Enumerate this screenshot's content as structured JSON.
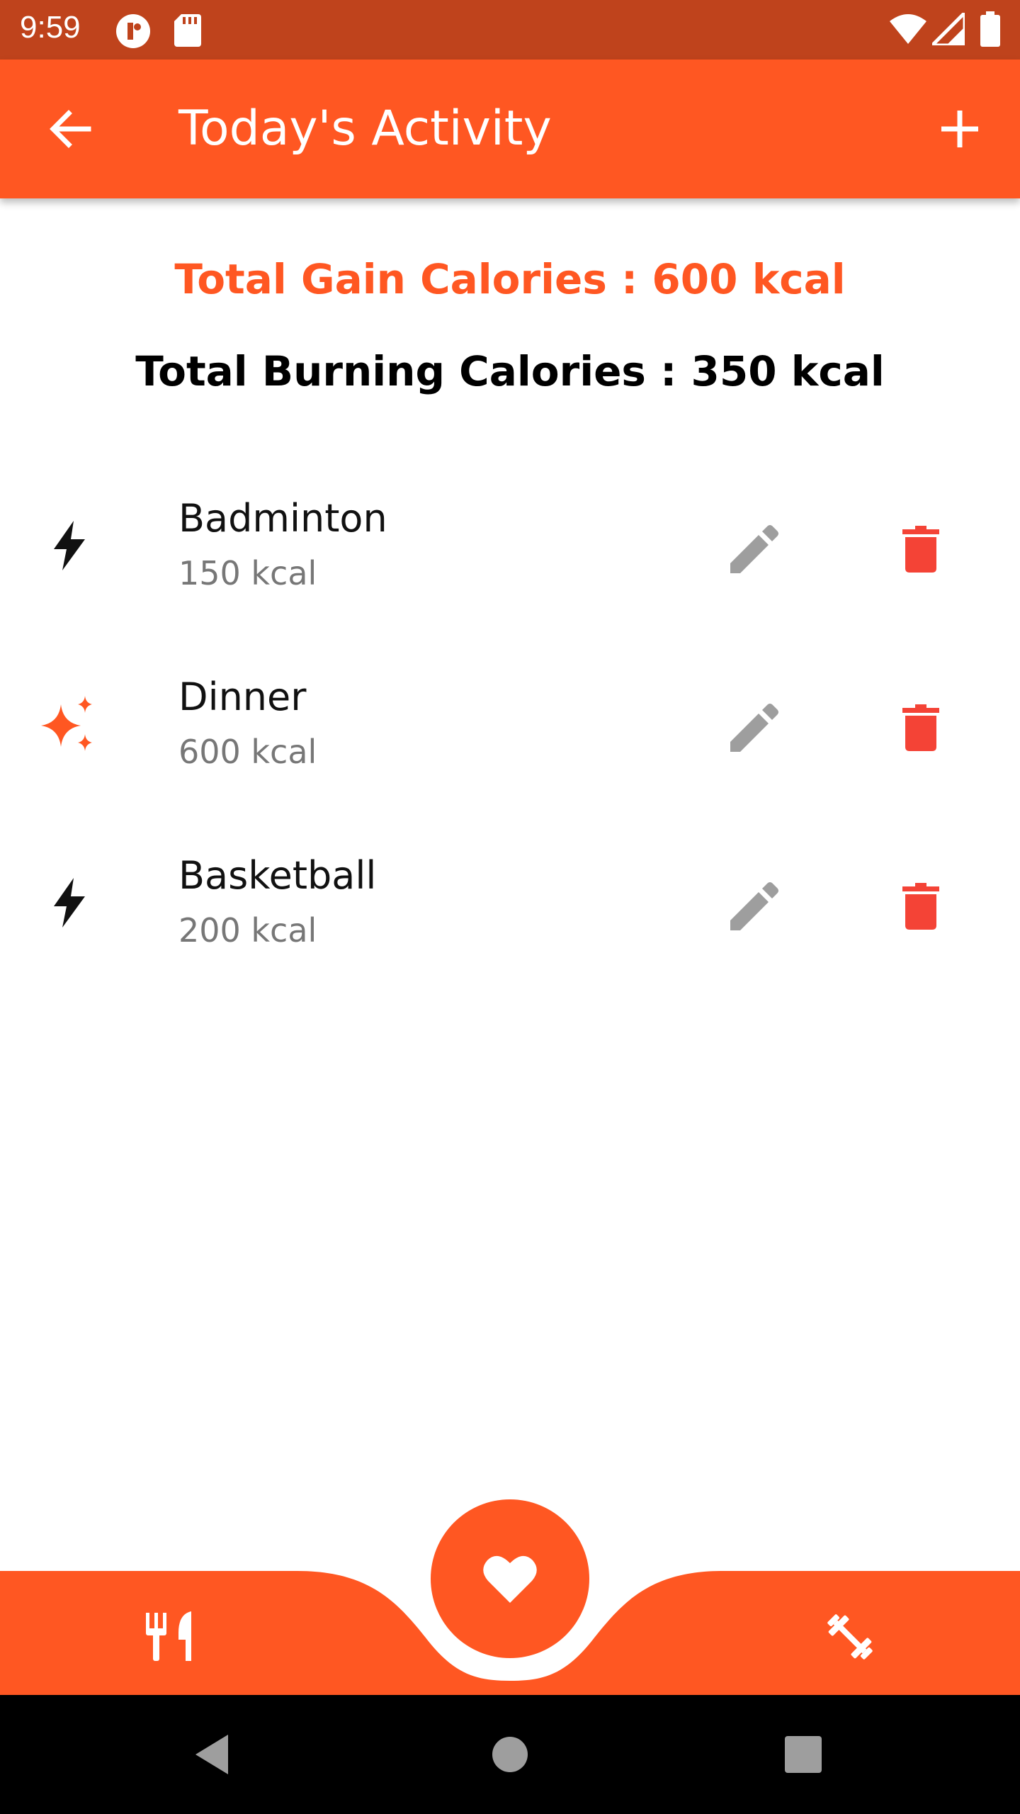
{
  "status_bar": {
    "time": "9:59"
  },
  "app_bar": {
    "title": "Today's Activity"
  },
  "summary": {
    "gain": "Total Gain Calories : 600 kcal",
    "burn": "Total Burning Calories : 350 kcal"
  },
  "activities": [
    {
      "name": "Badminton",
      "kcal": "150  kcal",
      "icon": "bolt-icon"
    },
    {
      "name": "Dinner",
      "kcal": "600  kcal",
      "icon": "sparkle-icon"
    },
    {
      "name": "Basketball",
      "kcal": "200  kcal",
      "icon": "bolt-icon"
    }
  ],
  "colors": {
    "primary": "#FF5722",
    "status_bar": "#BF431C",
    "delete": "#F44336",
    "edit": "#9E9E9E"
  },
  "bottom_nav": {
    "left_icon": "food-icon",
    "center_icon": "heart-icon",
    "right_icon": "dumbbell-icon"
  }
}
